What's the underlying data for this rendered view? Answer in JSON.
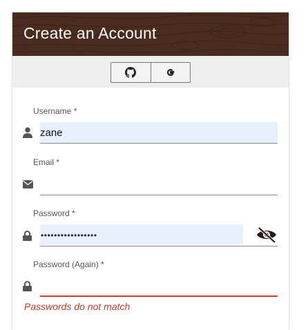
{
  "header": {
    "title": "Create an Account"
  },
  "oauth": {
    "github_icon": "github-icon",
    "google_icon": "google-icon"
  },
  "form": {
    "username": {
      "label": "Username *",
      "value": "zane",
      "icon": "user-icon"
    },
    "email": {
      "label": "Email *",
      "value": "",
      "icon": "envelope-icon"
    },
    "password": {
      "label": "Password *",
      "value": "•••••••••••••••••",
      "icon": "lock-icon",
      "toggle_icon": "eye-slash-icon"
    },
    "password_again": {
      "label": "Password (Again) *",
      "value": "",
      "icon": "lock-icon"
    },
    "error": "Passwords do not match"
  },
  "colors": {
    "header_bg": "#4a2c1f",
    "autofill_bg": "#e8f0fe",
    "error": "#c9372a"
  }
}
